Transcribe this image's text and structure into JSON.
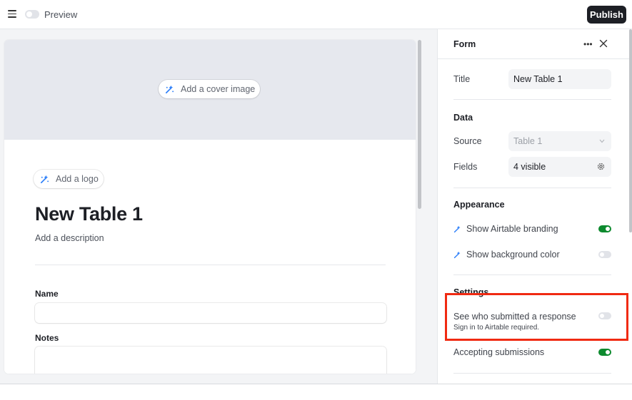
{
  "topbar": {
    "preview_label": "Preview",
    "publish_label": "Publish"
  },
  "form": {
    "cover_chip_label": "Add a cover image",
    "logo_chip_label": "Add a logo",
    "title": "New Table 1",
    "description": "Add a description",
    "fields": [
      {
        "label": "Name"
      },
      {
        "label": "Notes"
      }
    ]
  },
  "panel": {
    "title": "Form",
    "title_row": {
      "label": "Title",
      "value": "New Table 1"
    },
    "data_section": {
      "heading": "Data",
      "source": {
        "label": "Source",
        "value": "Table 1"
      },
      "fields": {
        "label": "Fields",
        "value": "4 visible"
      }
    },
    "appearance_section": {
      "heading": "Appearance",
      "branding": {
        "label": "Show Airtable branding",
        "on": true
      },
      "background": {
        "label": "Show background color",
        "on": false
      }
    },
    "settings_section": {
      "heading": "Settings",
      "submitter": {
        "label": "See who submitted a response",
        "hint": "Sign in to Airtable required.",
        "on": false
      },
      "accepting": {
        "label": "Accepting submissions",
        "on": true
      }
    }
  },
  "colors": {
    "toggle_on": "#0d8a2e",
    "highlight": "#f02a12",
    "wand_icon": "#2d7ff9"
  },
  "icons": [
    "menu-icon",
    "magic-wand-icon",
    "more-icon",
    "close-icon",
    "chevron-down-icon",
    "gear-icon"
  ]
}
